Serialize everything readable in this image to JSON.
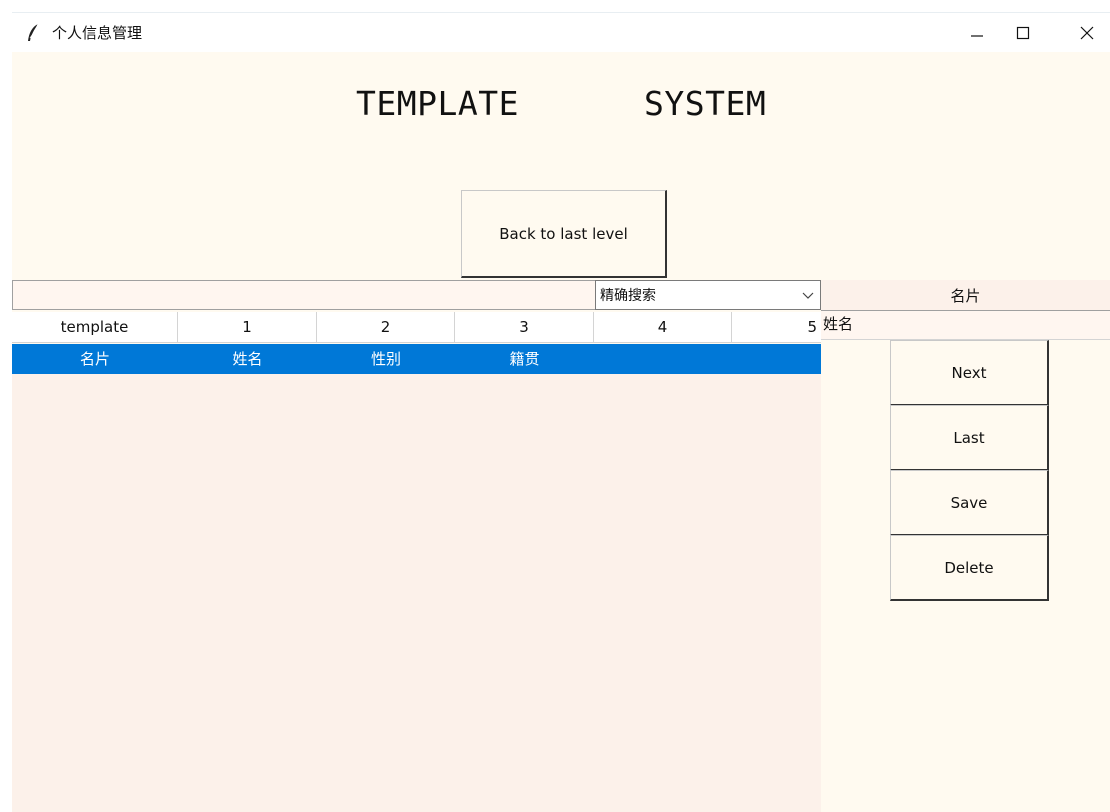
{
  "window": {
    "title": "个人信息管理"
  },
  "header": {
    "title_left": "TEMPLATE",
    "title_right": "SYSTEM"
  },
  "back_button": {
    "label": "Back to last level"
  },
  "search": {
    "mode_selected": "精确搜索",
    "entry_value": ""
  },
  "column_numbers": [
    "template",
    "1",
    "2",
    "3",
    "4",
    "5"
  ],
  "selected_row": [
    "名片",
    "姓名",
    "性别",
    "籍贯",
    "",
    ""
  ],
  "right_panel": {
    "card_label": "名片",
    "name_value": "姓名",
    "buttons": {
      "next": "Next",
      "last": "Last",
      "save": "Save",
      "delete": "Delete"
    }
  },
  "colors": {
    "background": "#fffaf0",
    "table_area": "#fcf1ea",
    "selection": "#0078d7"
  }
}
